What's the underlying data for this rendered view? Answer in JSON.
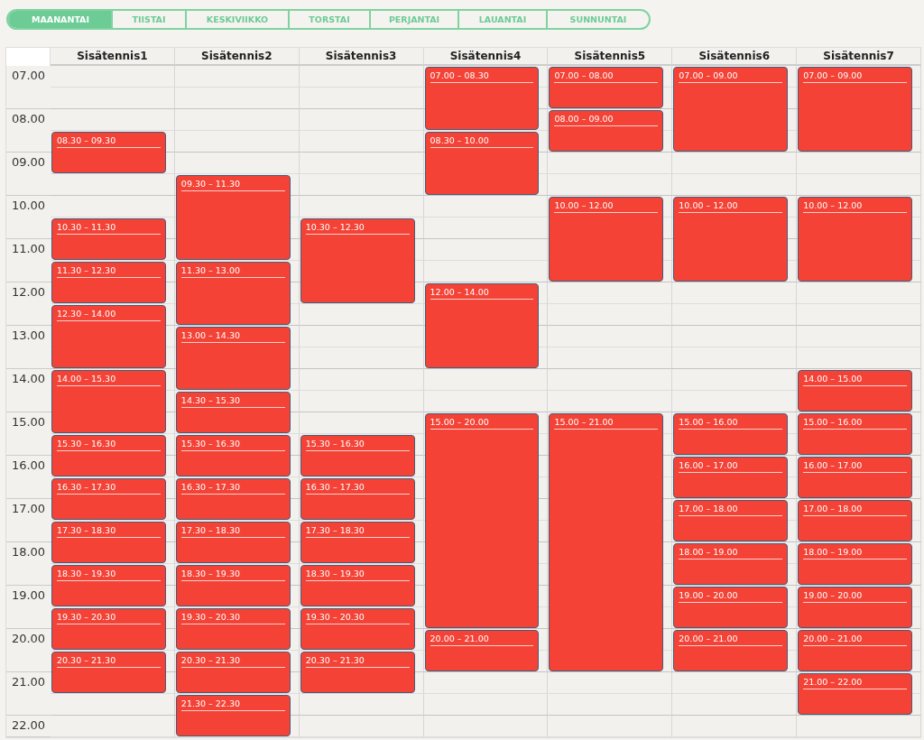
{
  "tabs": [
    {
      "label": "MAANANTAI",
      "selected": true
    },
    {
      "label": "TIISTAI",
      "selected": false
    },
    {
      "label": "KESKIVIIKKO",
      "selected": false
    },
    {
      "label": "TORSTAI",
      "selected": false
    },
    {
      "label": "PERJANTAI",
      "selected": false
    },
    {
      "label": "LAUANTAI",
      "selected": false
    },
    {
      "label": "SUNNUNTAI",
      "selected": false
    }
  ],
  "times": [
    "07.00",
    "08.00",
    "09.00",
    "10.00",
    "11.00",
    "12.00",
    "13.00",
    "14.00",
    "15.00",
    "16.00",
    "17.00",
    "18.00",
    "19.00",
    "20.00",
    "21.00",
    "22.00"
  ],
  "courts": [
    {
      "name": "Sisätennis1",
      "bookings": [
        "08.30 – 09.30",
        "10.30 – 11.30",
        "11.30 – 12.30",
        "12.30 – 14.00",
        "14.00 – 15.30",
        "15.30 – 16.30",
        "16.30 – 17.30",
        "17.30 – 18.30",
        "18.30 – 19.30",
        "19.30 – 20.30",
        "20.30 – 21.30"
      ]
    },
    {
      "name": "Sisätennis2",
      "bookings": [
        "09.30 – 11.30",
        "11.30 – 13.00",
        "13.00 – 14.30",
        "14.30 – 15.30",
        "15.30 – 16.30",
        "16.30 – 17.30",
        "17.30 – 18.30",
        "18.30 – 19.30",
        "19.30 – 20.30",
        "20.30 – 21.30",
        "21.30 – 22.30"
      ]
    },
    {
      "name": "Sisätennis3",
      "bookings": [
        "10.30 – 12.30",
        "15.30 – 16.30",
        "16.30 – 17.30",
        "17.30 – 18.30",
        "18.30 – 19.30",
        "19.30 – 20.30",
        "20.30 – 21.30"
      ]
    },
    {
      "name": "Sisätennis4",
      "bookings": [
        "07.00 – 08.30",
        "08.30 – 10.00",
        "12.00 – 14.00",
        "15.00 – 20.00",
        "20.00 – 21.00"
      ]
    },
    {
      "name": "Sisätennis5",
      "bookings": [
        "07.00 – 08.00",
        "08.00 – 09.00",
        "10.00 – 12.00",
        "15.00 – 21.00"
      ]
    },
    {
      "name": "Sisätennis6",
      "bookings": [
        "07.00 – 09.00",
        "10.00 – 12.00",
        "15.00 – 16.00",
        "16.00 – 17.00",
        "17.00 – 18.00",
        "18.00 – 19.00",
        "19.00 – 20.00",
        "20.00 – 21.00"
      ]
    },
    {
      "name": "Sisätennis7",
      "bookings": [
        "07.00 – 09.00",
        "10.00 – 12.00",
        "14.00 – 15.00",
        "15.00 – 16.00",
        "16.00 – 17.00",
        "17.00 – 18.00",
        "18.00 – 19.00",
        "19.00 – 20.00",
        "20.00 – 21.00",
        "21.00 – 22.00"
      ]
    }
  ]
}
